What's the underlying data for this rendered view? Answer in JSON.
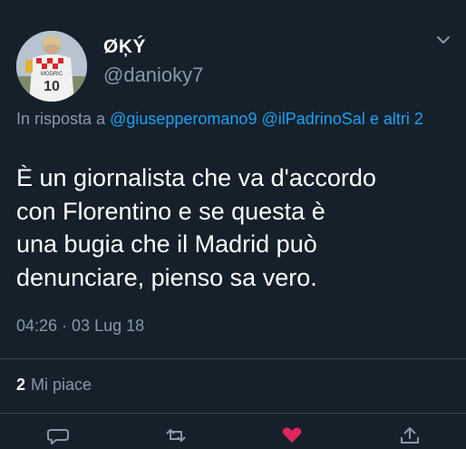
{
  "tweet": {
    "display_name": "ØĶÝ",
    "handle": "@danioky7",
    "reply_prefix": "In risposta a",
    "reply_mentions": [
      "@giusepperomano9",
      "@ilPadrinoSal"
    ],
    "reply_suffix": "e altri 2",
    "text": "È un giornalista che va d'accordo\ncon Florentino e se questa è\nuna bugia che il Madrid può\ndenunciare, pienso sa vero.",
    "timestamp": "04:26 · 03 Lug 18",
    "likes_count": "2",
    "likes_label": "Mi piace",
    "avatar_jersey_name": "MODRIC",
    "avatar_jersey_number": "10"
  },
  "icons": {
    "caret": "chevron-down-icon",
    "actions": [
      "reply-icon",
      "retweet-icon",
      "like-icon",
      "share-icon"
    ]
  },
  "colors": {
    "background": "#15202b",
    "accent": "#1da1f2",
    "secondary_text": "#8899a6",
    "like": "#e0245e"
  }
}
